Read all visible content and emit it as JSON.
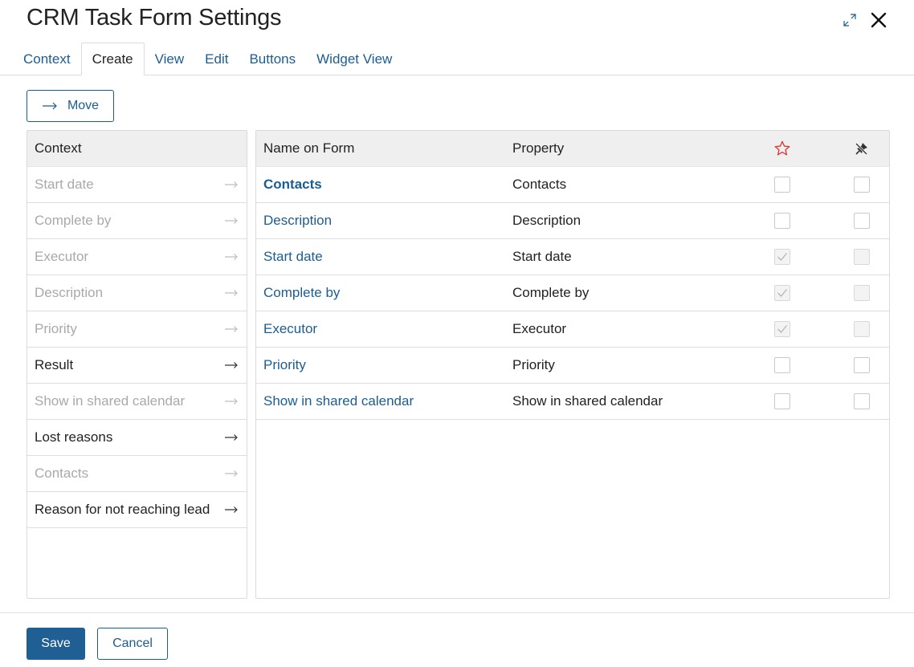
{
  "dialog": {
    "title": "CRM Task Form Settings",
    "expand_icon": "expand-icon",
    "close_icon": "close-icon"
  },
  "tabs": [
    {
      "label": "Context",
      "active": false
    },
    {
      "label": "Create",
      "active": true
    },
    {
      "label": "View",
      "active": false
    },
    {
      "label": "Edit",
      "active": false
    },
    {
      "label": "Buttons",
      "active": false
    },
    {
      "label": "Widget View",
      "active": false
    }
  ],
  "toolbar": {
    "move_label": "Move",
    "move_icon": "arrow-right-icon"
  },
  "context_panel": {
    "header": "Context",
    "items": [
      {
        "label": "Start date",
        "enabled": false
      },
      {
        "label": "Complete by",
        "enabled": false
      },
      {
        "label": "Executor",
        "enabled": false
      },
      {
        "label": "Description",
        "enabled": false
      },
      {
        "label": "Priority",
        "enabled": false
      },
      {
        "label": "Result",
        "enabled": true
      },
      {
        "label": "Show in shared calendar",
        "enabled": false
      },
      {
        "label": "Lost reasons",
        "enabled": true
      },
      {
        "label": "Contacts",
        "enabled": false
      },
      {
        "label": "Reason for not reaching lead",
        "enabled": true
      }
    ]
  },
  "fields_table": {
    "headers": {
      "name": "Name on Form",
      "property": "Property",
      "required_icon": "star-icon",
      "readonly_icon": "pin-off-icon"
    },
    "rows": [
      {
        "name": "Contacts",
        "property": "Contacts",
        "required": false,
        "required_disabled": false,
        "readonly": false,
        "readonly_disabled": false,
        "bold": true
      },
      {
        "name": "Description",
        "property": "Description",
        "required": false,
        "required_disabled": false,
        "readonly": false,
        "readonly_disabled": false,
        "bold": false
      },
      {
        "name": "Start date",
        "property": "Start date",
        "required": true,
        "required_disabled": true,
        "readonly": false,
        "readonly_disabled": true,
        "bold": false
      },
      {
        "name": "Complete by",
        "property": "Complete by",
        "required": true,
        "required_disabled": true,
        "readonly": false,
        "readonly_disabled": true,
        "bold": false
      },
      {
        "name": "Executor",
        "property": "Executor",
        "required": true,
        "required_disabled": true,
        "readonly": false,
        "readonly_disabled": true,
        "bold": false
      },
      {
        "name": "Priority",
        "property": "Priority",
        "required": false,
        "required_disabled": false,
        "readonly": false,
        "readonly_disabled": false,
        "bold": false
      },
      {
        "name": "Show in shared calendar",
        "property": "Show in shared calendar",
        "required": false,
        "required_disabled": false,
        "readonly": false,
        "readonly_disabled": false,
        "bold": false
      }
    ]
  },
  "footer": {
    "save_label": "Save",
    "cancel_label": "Cancel"
  },
  "colors": {
    "link": "#1c5d91",
    "primary_button": "#1f5f93",
    "star": "#e0322f",
    "disabled_text": "#a9a9a9"
  }
}
